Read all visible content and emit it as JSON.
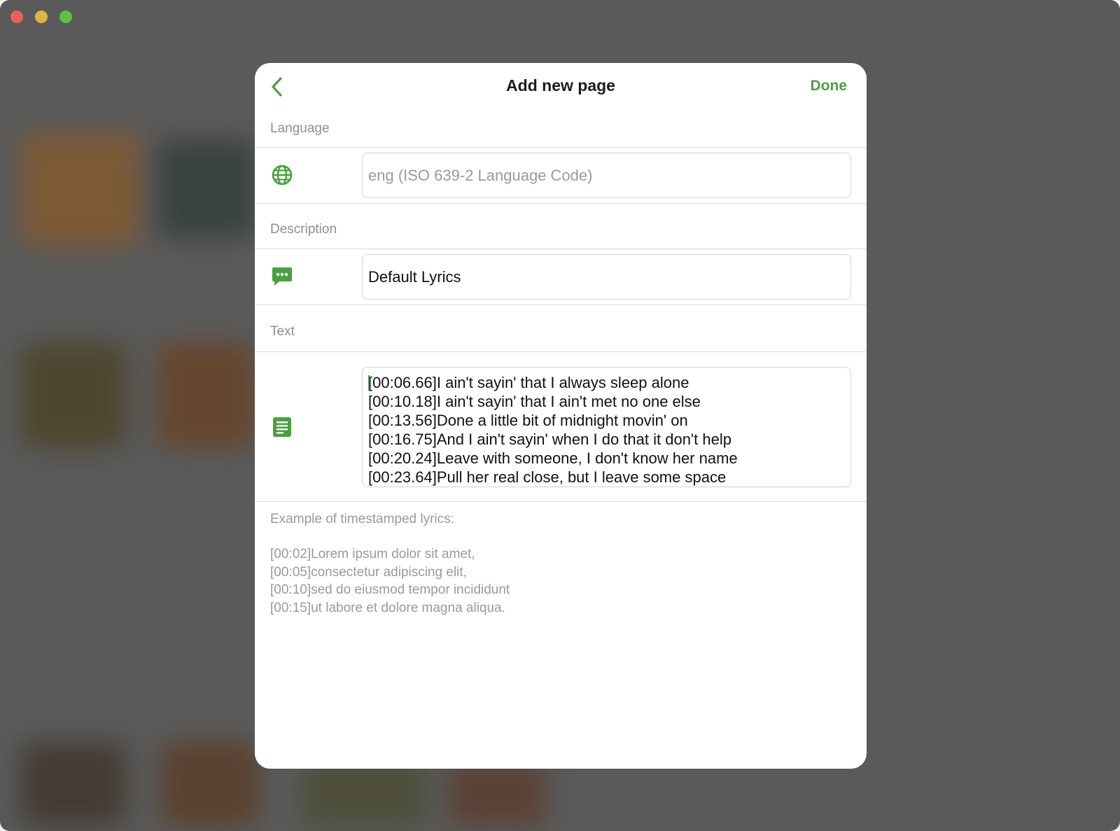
{
  "window": {
    "controls": [
      "close",
      "minimize",
      "maximize"
    ]
  },
  "dialog": {
    "title": "Add new page",
    "back_icon": "chevron-left-icon",
    "done_label": "Done",
    "accent_color": "#4aa03f",
    "language": {
      "header": "Language",
      "icon": "globe-icon",
      "value": "",
      "placeholder": "eng (ISO 639-2 Language Code)"
    },
    "description": {
      "header": "Description",
      "icon": "message-bubble-icon",
      "value": "Default Lyrics"
    },
    "text": {
      "header": "Text",
      "icon": "document-text-icon",
      "lines": [
        "[00:06.66]I ain't sayin' that I always sleep alone",
        "[00:10.18]I ain't sayin' that I ain't met no one else",
        "[00:13.56]Done a little bit of midnight movin' on",
        "[00:16.75]And I ain't sayin' when I do that it don't help",
        "[00:20.24]Leave with someone, I don't know her name",
        "[00:23.64]Pull her real close, but I leave some space"
      ]
    },
    "example": {
      "heading": "Example of timestamped lyrics:",
      "lines": [
        "[00:02]Lorem ipsum dolor sit amet,",
        "[00:05]consectetur adipiscing elit,",
        "[00:10]sed do eiusmod tempor incididunt",
        "[00:15]ut labore et dolore magna aliqua."
      ]
    }
  }
}
